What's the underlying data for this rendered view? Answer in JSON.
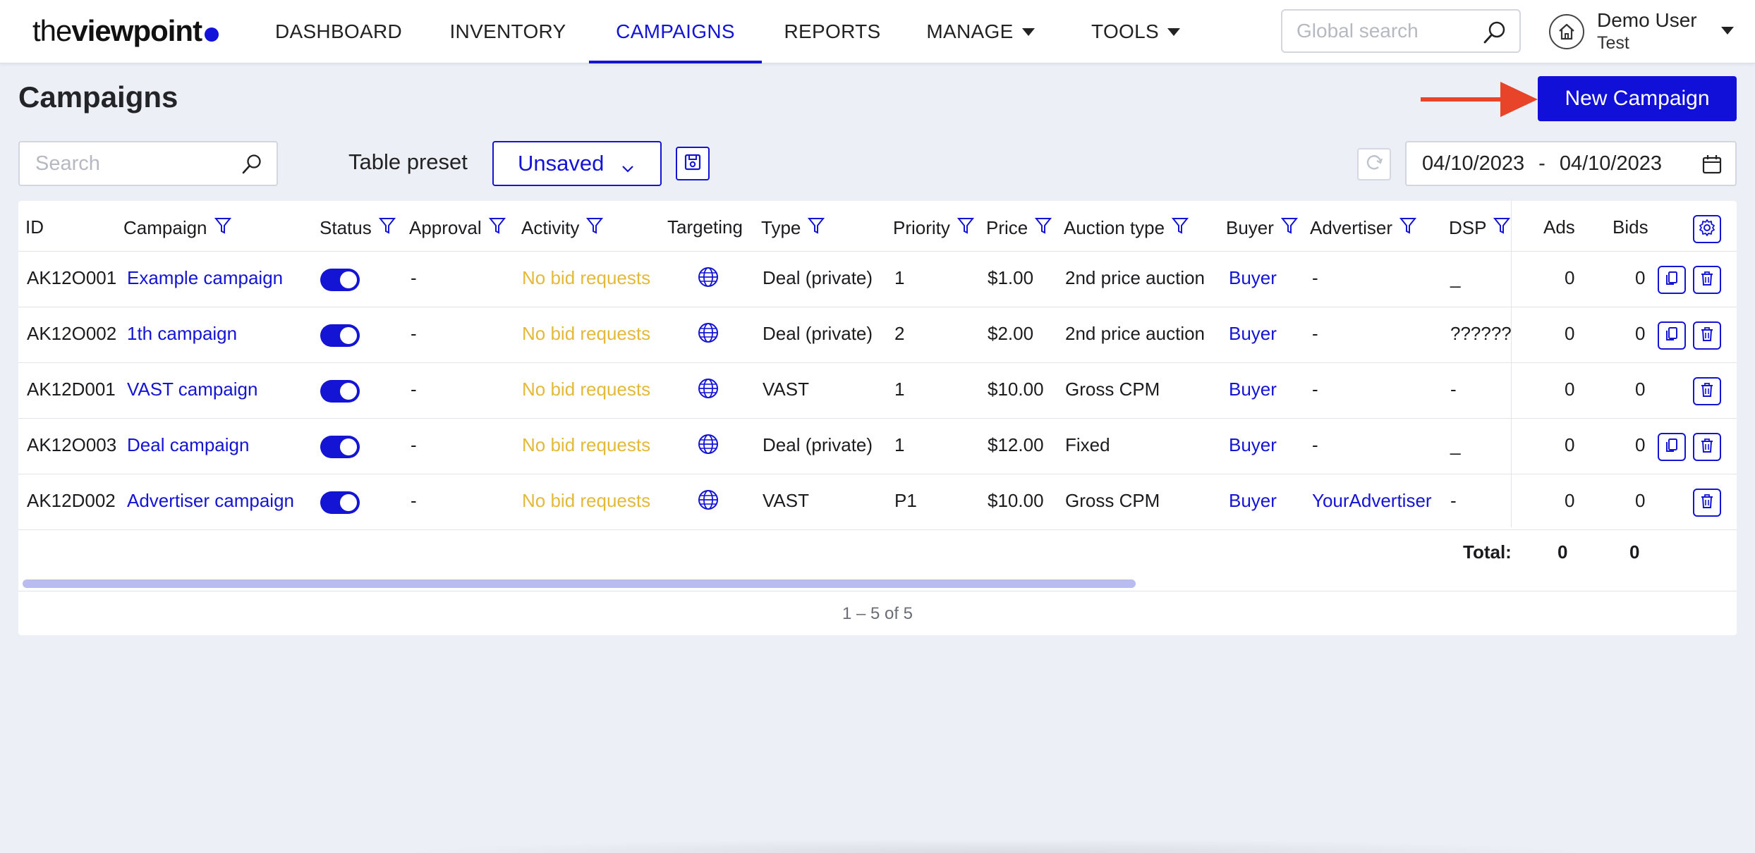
{
  "brand": {
    "logo_light": "the",
    "logo_bold": "viewpoint"
  },
  "nav": {
    "dashboard": "DASHBOARD",
    "inventory": "INVENTORY",
    "campaigns": "CAMPAIGNS",
    "reports": "REPORTS",
    "manage": "MANAGE",
    "tools": "TOOLS"
  },
  "global_search": {
    "placeholder": "Global search"
  },
  "user": {
    "name": "Demo User",
    "org": "Test"
  },
  "page": {
    "title": "Campaigns",
    "new_button": "New Campaign"
  },
  "toolbar": {
    "search_placeholder": "Search",
    "preset_label": "Table preset",
    "preset_value": "Unsaved",
    "date_from": "04/10/2023",
    "date_sep": "-",
    "date_to": "04/10/2023"
  },
  "table": {
    "headers": {
      "id": "ID",
      "campaign": "Campaign",
      "status": "Status",
      "approval": "Approval",
      "activity": "Activity",
      "targeting": "Targeting",
      "type": "Type",
      "priority": "Priority",
      "price": "Price",
      "auction": "Auction type",
      "buyer": "Buyer",
      "advertiser": "Advertiser",
      "dsp": "DSP",
      "ads": "Ads",
      "bids": "Bids"
    },
    "rows": [
      {
        "id": "AK12O001",
        "campaign": "Example campaign",
        "status_on": true,
        "approval": "-",
        "activity": "No bid requests",
        "type": "Deal (private)",
        "priority": "1",
        "price": "$1.00",
        "auction": "2nd price auction",
        "buyer": "Buyer",
        "advertiser": "-",
        "dsp": "_",
        "ads": "0",
        "bids": "0"
      },
      {
        "id": "AK12O002",
        "campaign": "1th campaign",
        "status_on": true,
        "approval": "-",
        "activity": "No bid requests",
        "type": "Deal (private)",
        "priority": "2",
        "price": "$2.00",
        "auction": "2nd price auction",
        "buyer": "Buyer",
        "advertiser": "-",
        "dsp": "??????",
        "ads": "0",
        "bids": "0"
      },
      {
        "id": "AK12D001",
        "campaign": "VAST campaign",
        "status_on": true,
        "approval": "-",
        "activity": "No bid requests",
        "type": "VAST",
        "priority": "1",
        "price": "$10.00",
        "auction": "Gross CPM",
        "buyer": "Buyer",
        "advertiser": "-",
        "dsp": "-",
        "ads": "0",
        "bids": "0"
      },
      {
        "id": "AK12O003",
        "campaign": "Deal campaign",
        "status_on": true,
        "approval": "-",
        "activity": "No bid requests",
        "type": "Deal (private)",
        "priority": "1",
        "price": "$12.00",
        "auction": "Fixed",
        "buyer": "Buyer",
        "advertiser": "-",
        "dsp": "_",
        "ads": "0",
        "bids": "0"
      },
      {
        "id": "AK12D002",
        "campaign": "Advertiser campaign",
        "status_on": true,
        "approval": "-",
        "activity": "No bid requests",
        "type": "VAST",
        "priority": "P1",
        "price": "$10.00",
        "auction": "Gross CPM",
        "buyer": "Buyer",
        "advertiser": "YourAdvertiser",
        "dsp": "-",
        "ads": "0",
        "bids": "0"
      }
    ],
    "total_label": "Total:",
    "total_ads": "0",
    "total_bids": "0",
    "pager": "1 – 5 of 5"
  },
  "colors": {
    "accent": "#1414d4",
    "activity": "#e3b93a",
    "arrow": "#e8442a"
  },
  "icons": [
    "search-icon",
    "home-icon",
    "chevron-down-icon",
    "save-icon",
    "refresh-icon",
    "calendar-icon",
    "filter-icon",
    "globe-icon",
    "copy-icon",
    "trash-icon",
    "gear-icon",
    "arrow-right-icon"
  ]
}
